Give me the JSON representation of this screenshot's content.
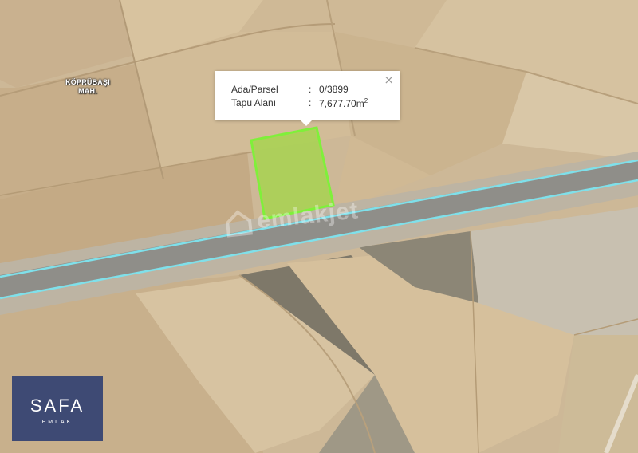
{
  "map": {
    "place_label_line1": "KÖPRÜBAŞI",
    "place_label_line2": "MAH.",
    "watermark_text": "emlakjet",
    "parcel_fill_color": "#a4d64a",
    "parcel_stroke_color": "#7ff03a",
    "road_edge_color": "#7fe0ea"
  },
  "popup": {
    "rows": [
      {
        "label": "Ada/Parsel",
        "separator": ":",
        "value": "0/3899"
      },
      {
        "label": "Tapu Alanı",
        "separator": ":",
        "value": "7,677.70m",
        "unit_sup": "2"
      }
    ],
    "close_glyph": "×"
  },
  "logo": {
    "brand": "SAFA",
    "subtitle": "EMLAK",
    "background_color": "#3e4a74"
  }
}
